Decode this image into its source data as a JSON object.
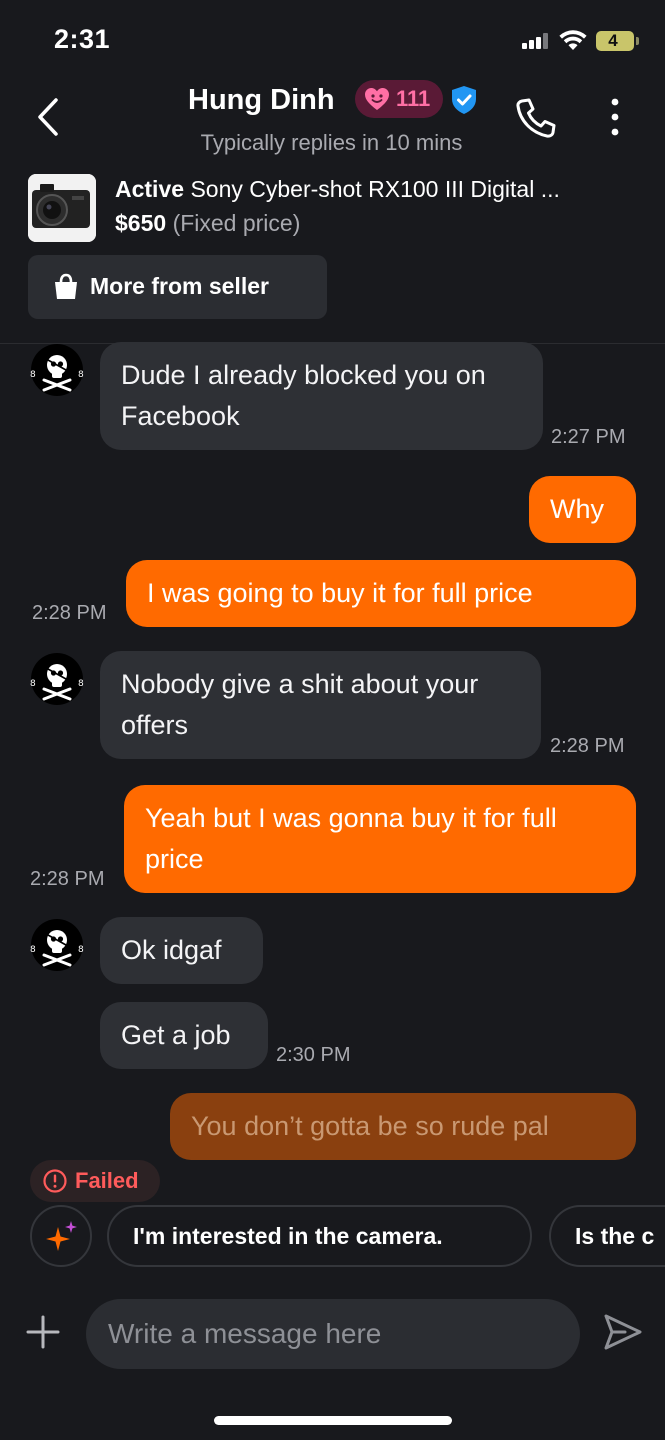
{
  "status_bar": {
    "time": "2:31",
    "battery_level": "4",
    "icons": [
      "signal-icon",
      "wifi-icon",
      "battery-icon"
    ]
  },
  "header": {
    "seller_name": "Hung Dinh",
    "heart_count": "111",
    "response_time": "Typically replies in 10 mins",
    "icons": [
      "back-icon",
      "heart-icon",
      "verified-icon",
      "phone-icon",
      "more-icon"
    ]
  },
  "listing": {
    "status": "Active",
    "title": "Sony Cyber-shot RX100 III Digital ...",
    "price": "$650",
    "price_type": "(Fixed price)",
    "more_from_seller_label": "More from seller",
    "icons": [
      "shopping-bag-icon"
    ]
  },
  "messages": [
    {
      "sender": "seller",
      "text": "Dude I already blocked you on Facebook",
      "time": "2:27 PM"
    },
    {
      "sender": "me",
      "text": "Why",
      "time": ""
    },
    {
      "sender": "me",
      "text": "I was going to buy it for full price",
      "time": "2:28 PM"
    },
    {
      "sender": "seller",
      "text": "Nobody give a shit about your offers",
      "time": "2:28 PM"
    },
    {
      "sender": "me",
      "text": "Yeah but I was gonna buy it for full price",
      "time": "2:28 PM"
    },
    {
      "sender": "seller",
      "text": "Ok idgaf",
      "time": ""
    },
    {
      "sender": "seller",
      "text": "Get a job",
      "time": "2:30 PM"
    },
    {
      "sender": "me",
      "text": "You don’t gotta be so rude pal",
      "time": "",
      "status": "Failed"
    }
  ],
  "suggestions": {
    "chips": [
      "I'm interested in the camera.",
      "Is the c"
    ],
    "icons": [
      "sparkle-icon"
    ]
  },
  "composer": {
    "placeholder": "Write a message here",
    "value": "",
    "icons": [
      "plus-icon",
      "send-icon"
    ]
  },
  "colors": {
    "background": "#18191d",
    "incoming_bubble": "#2e3035",
    "outgoing_bubble": "#ff6a00",
    "failed_bubble": "#8a400f",
    "failed_text": "#ff5b5b",
    "verified_blue": "#2196f3",
    "heart_pink": "#ff6fa5"
  }
}
